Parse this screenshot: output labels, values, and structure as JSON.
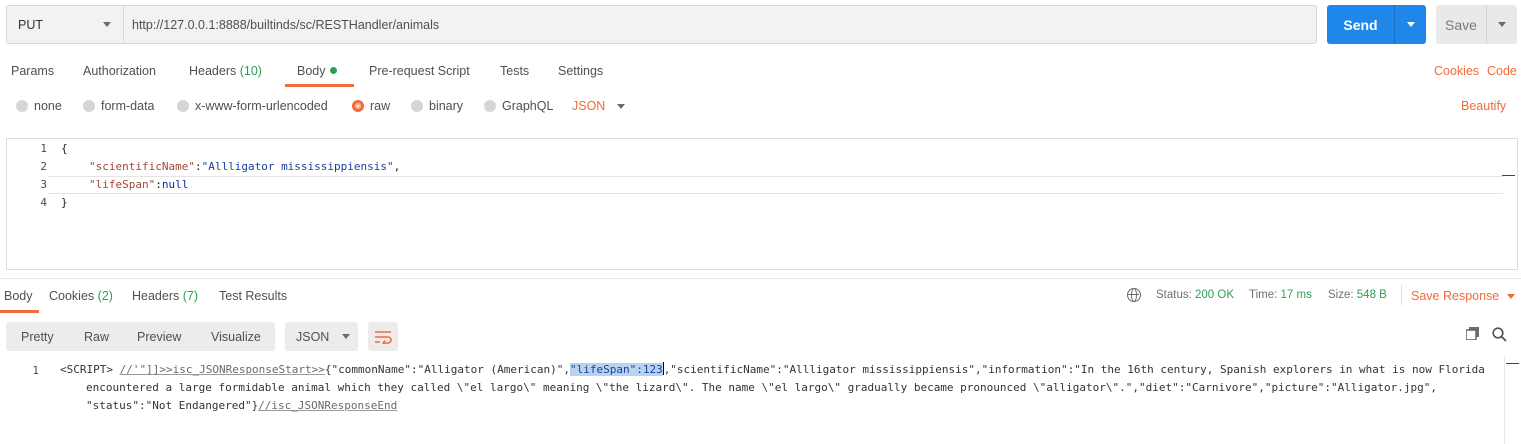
{
  "request": {
    "method": "PUT",
    "url": "http://127.0.0.1:8888/builtinds/sc/RESTHandler/animals",
    "send_label": "Send",
    "save_label": "Save"
  },
  "tabs": [
    {
      "label": "Params"
    },
    {
      "label": "Authorization"
    },
    {
      "label": "Headers",
      "count": "(10)"
    },
    {
      "label": "Body"
    },
    {
      "label": "Pre-request Script"
    },
    {
      "label": "Tests"
    },
    {
      "label": "Settings"
    }
  ],
  "links": {
    "cookies": "Cookies",
    "code": "Code",
    "beautify": "Beautify"
  },
  "body_types": [
    "none",
    "form-data",
    "x-www-form-urlencoded",
    "raw",
    "binary",
    "GraphQL"
  ],
  "selected_body_type": "raw",
  "format": "JSON",
  "editor": {
    "line_numbers": [
      "1",
      "2",
      "3",
      "4"
    ],
    "open_brace": "{",
    "close_brace": "}",
    "key1": "\"scientificName\"",
    "value1": "\"Allligator mississippiensis\"",
    "key2": "\"lifeSpan\"",
    "value2": "null",
    "colon": ":",
    "comma": ","
  },
  "response": {
    "tabs": [
      {
        "label": "Body"
      },
      {
        "label": "Cookies",
        "count": "(2)"
      },
      {
        "label": "Headers",
        "count": "(7)"
      },
      {
        "label": "Test Results"
      }
    ],
    "status_label": "Status:",
    "status_value": "200 OK",
    "time_label": "Time:",
    "time_value": "17 ms",
    "size_label": "Size:",
    "size_value": "548 B",
    "save_response": "Save Response",
    "views": [
      "Pretty",
      "Raw",
      "Preview",
      "Visualize"
    ],
    "format": "JSON",
    "line_number": "1",
    "line1_prefix": "<SCRIPT> ",
    "line1_comment": "//'\"]]>>isc_JSONResponseStart>>",
    "line1_a": "{\"commonName\":\"Alligator (American)\",",
    "line1_highlight": "\"lifeSpan\":123",
    "line1_b": ",\"scientificName\":\"Allligator mississippiensis\",\"information\":\"In the 16th century, Spanish explorers in what is now Florida",
    "line2": "encountered a large formidable animal which they called \\\"el largo\\\" meaning \\\"the lizard\\\". The name \\\"el largo\\\" gradually became pronounced \\\"alligator\\\".\",\"diet\":\"Carnivore\",\"picture\":\"Alligator.jpg\",",
    "line3_a": "\"status\":\"Not Endangered\"}",
    "line3_comment": "//isc_JSONResponseEnd"
  },
  "colors": {
    "accent": "#f26b3a",
    "primary": "#1f86ea",
    "success": "#2e9e54"
  }
}
